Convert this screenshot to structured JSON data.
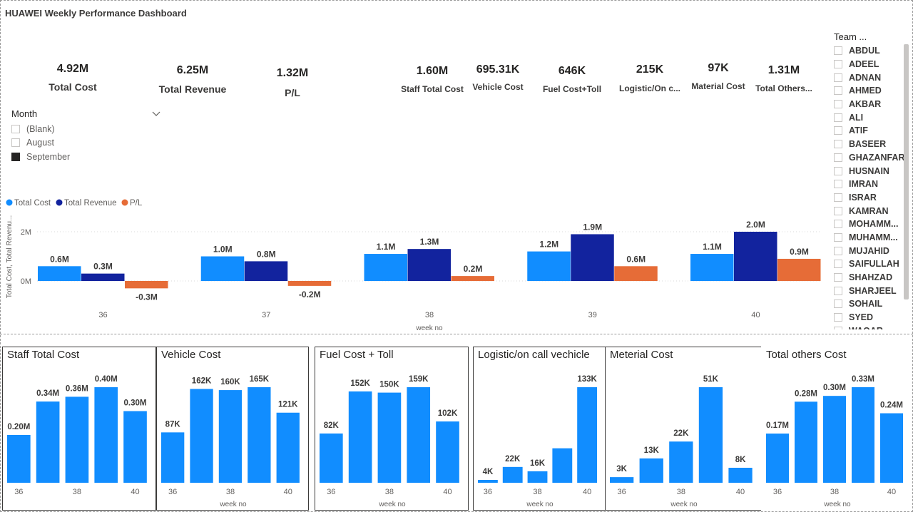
{
  "header": {
    "title": "HUAWEI Weekly Performance Dashboard"
  },
  "kpis": [
    {
      "value": "4.92M",
      "label": "Total Cost"
    },
    {
      "value": "6.25M",
      "label": "Total Revenue"
    },
    {
      "value": "1.32M",
      "label": "P/L"
    },
    {
      "value": "1.60M",
      "label": "Staff Total Cost"
    },
    {
      "value": "695.31K",
      "label": "Vehicle Cost"
    },
    {
      "value": "646K",
      "label": "Fuel Cost+Toll"
    },
    {
      "value": "215K",
      "label": "Logistic/On c..."
    },
    {
      "value": "97K",
      "label": "Material Cost"
    },
    {
      "value": "1.31M",
      "label": "Total Others..."
    }
  ],
  "month_slicer": {
    "title": "Month",
    "items": [
      {
        "label": "(Blank)",
        "checked": false
      },
      {
        "label": "August",
        "checked": false
      },
      {
        "label": "September",
        "checked": true
      }
    ]
  },
  "team_slicer": {
    "title": "Team ...",
    "items": [
      "ABDUL",
      "ADEEL",
      "ADNAN",
      "AHMED",
      "AKBAR",
      "ALI",
      "ATIF",
      "BASEER",
      "GHAZANFAR",
      "HUSNAIN",
      "IMRAN",
      "ISRAR",
      "KAMRAN",
      "MOHAMM...",
      "MUHAMM...",
      "MUJAHID",
      "SAIFULLAH",
      "SHAHZAD",
      "SHARJEEL",
      "SOHAIL",
      "SYED",
      "WAQAR"
    ]
  },
  "colors": {
    "total_cost": "#118dff",
    "total_revenue": "#12239e",
    "pl": "#e66c37",
    "axis_text": "#605e5c",
    "label_text": "#3b3a39"
  },
  "chart_data": [
    {
      "type": "bar",
      "categories": [
        "36",
        "37",
        "38",
        "39",
        "40"
      ],
      "xlabel": "week no",
      "ylabel": "Total Cost, Total Revenu...",
      "yticks": [
        "0M",
        "2M"
      ],
      "ylim": [
        -0.5,
        2.2
      ],
      "legend": "top-left",
      "series": [
        {
          "name": "Total Cost",
          "values": [
            0.6,
            1.0,
            1.1,
            1.2,
            1.1
          ],
          "labels": [
            "0.6M",
            "1.0M",
            "1.1M",
            "1.2M",
            "1.1M"
          ]
        },
        {
          "name": "Total Revenue",
          "values": [
            0.3,
            0.8,
            1.3,
            1.9,
            2.0
          ],
          "labels": [
            "0.3M",
            "0.8M",
            "1.3M",
            "1.9M",
            "2.0M"
          ]
        },
        {
          "name": "P/L",
          "values": [
            -0.3,
            -0.2,
            0.2,
            0.6,
            0.9
          ],
          "labels": [
            "-0.3M",
            "-0.2M",
            "0.2M",
            "0.6M",
            "0.9M"
          ]
        }
      ]
    },
    {
      "type": "bar",
      "title": "Staff Total Cost",
      "xlabel": "",
      "categories": [
        "36",
        "37",
        "38",
        "39",
        "40"
      ],
      "tick_labels": [
        "36",
        "",
        "38",
        "",
        "40"
      ],
      "values": [
        0.2,
        0.34,
        0.36,
        0.4,
        0.3
      ],
      "labels": [
        "0.20M",
        "0.34M",
        "0.36M",
        "0.40M",
        "0.30M"
      ]
    },
    {
      "type": "bar",
      "title": "Vehicle Cost",
      "xlabel": "week no",
      "categories": [
        "36",
        "37",
        "38",
        "39",
        "40"
      ],
      "tick_labels": [
        "36",
        "",
        "38",
        "",
        "40"
      ],
      "values": [
        87,
        162,
        160,
        165,
        121
      ],
      "labels": [
        "87K",
        "162K",
        "160K",
        "165K",
        "121K"
      ]
    },
    {
      "type": "bar",
      "title": "Fuel Cost + Toll",
      "xlabel": "week no",
      "categories": [
        "36",
        "37",
        "38",
        "39",
        "40"
      ],
      "tick_labels": [
        "36",
        "",
        "38",
        "",
        "40"
      ],
      "values": [
        82,
        152,
        150,
        159,
        102
      ],
      "labels": [
        "82K",
        "152K",
        "150K",
        "159K",
        "102K"
      ]
    },
    {
      "type": "bar",
      "title": "Logistic/on call vechicle",
      "xlabel": "week no",
      "categories": [
        "36",
        "37",
        "38",
        "39",
        "40"
      ],
      "tick_labels": [
        "36",
        "",
        "38",
        "",
        "40"
      ],
      "values": [
        4,
        22,
        16,
        48,
        133
      ],
      "labels": [
        "4K",
        "22K",
        "16K",
        "",
        "133K"
      ]
    },
    {
      "type": "bar",
      "title": "Meterial Cost",
      "xlabel": "week no",
      "categories": [
        "36",
        "37",
        "38",
        "39",
        "40"
      ],
      "tick_labels": [
        "36",
        "",
        "38",
        "",
        "40"
      ],
      "values": [
        3,
        13,
        22,
        51,
        8
      ],
      "labels": [
        "3K",
        "13K",
        "22K",
        "51K",
        "8K"
      ]
    },
    {
      "type": "bar",
      "title": "Total others Cost",
      "xlabel": "week no",
      "categories": [
        "36",
        "37",
        "38",
        "39",
        "40"
      ],
      "tick_labels": [
        "36",
        "",
        "38",
        "",
        "40"
      ],
      "values": [
        0.17,
        0.28,
        0.3,
        0.33,
        0.24
      ],
      "labels": [
        "0.17M",
        "0.28M",
        "0.30M",
        "0.33M",
        "0.24M"
      ]
    }
  ]
}
